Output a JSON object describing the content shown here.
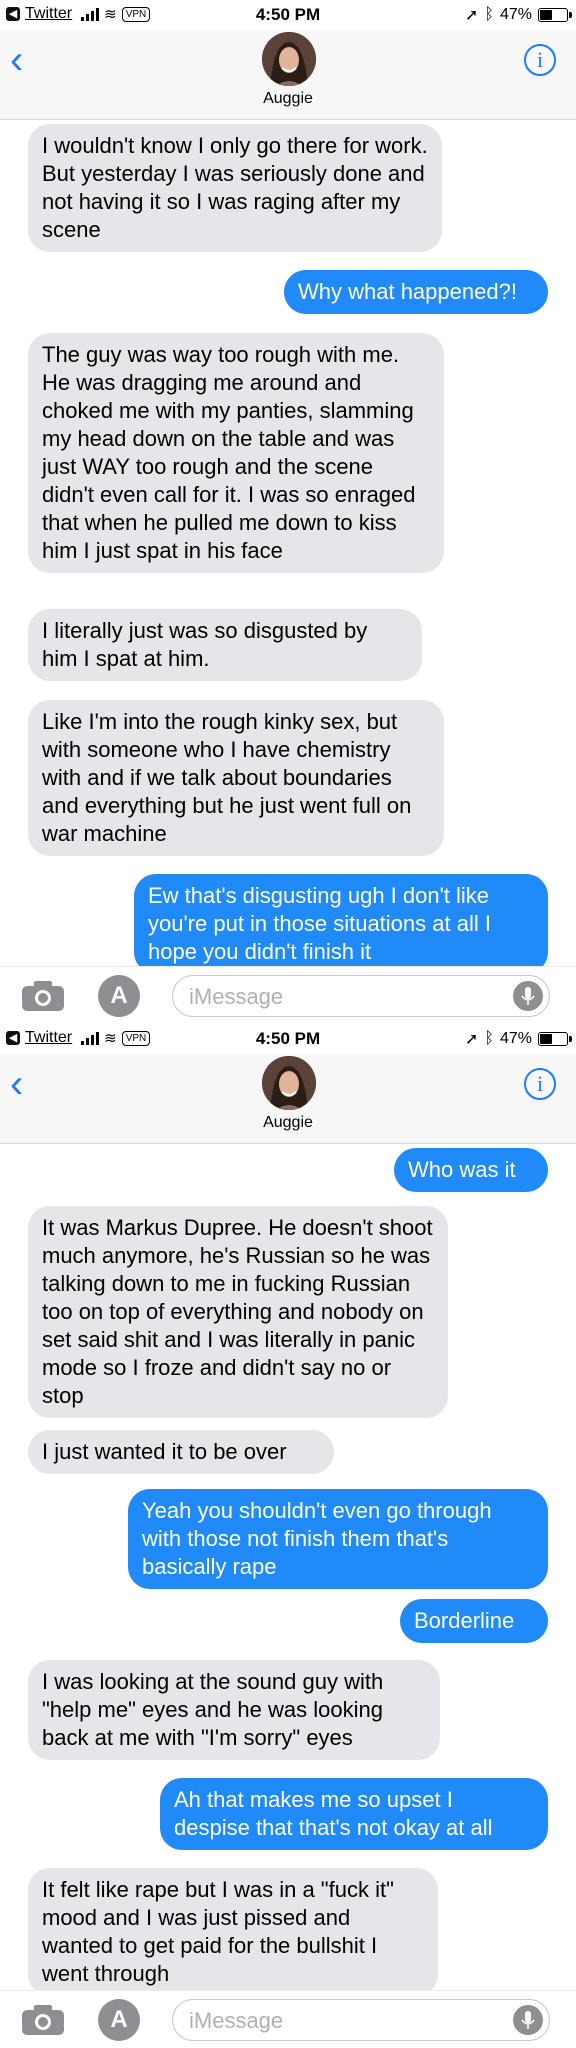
{
  "status": {
    "back_app": "Twitter",
    "vpn": "VPN",
    "time": "4:50 PM",
    "battery": "47%",
    "battery_level": 0.47
  },
  "contact": {
    "name": "Auggie"
  },
  "input": {
    "placeholder": "iMessage"
  },
  "screens": [
    {
      "messages": [
        {
          "side": "received",
          "text": "I wouldn't know I only go there for work. But yesterday I was seriously done and not having it so I was raging after my scene"
        },
        {
          "side": "sent",
          "text": "Why what happened?!"
        },
        {
          "side": "received",
          "text": "The guy was way too rough with me. He was dragging me around and choked me with my panties, slamming my head down on the table and was just WAY too rough and the scene didn't even call for it. I was so enraged that when he pulled me down to kiss him I just spat in his face"
        },
        {
          "side": "received",
          "text": "I literally just was so disgusted by him I spat at him."
        },
        {
          "side": "received",
          "text": "Like I'm into the rough kinky sex, but with someone who I have chemistry with and if we talk about boundaries and everything but he just went full on war machine"
        },
        {
          "side": "sent",
          "text": "Ew that's disgusting ugh I don't like you're put in those situations at all I hope you didn't finish it"
        }
      ]
    },
    {
      "messages": [
        {
          "side": "sent",
          "text": "Who was it"
        },
        {
          "side": "received",
          "text": "It was Markus Dupree. He doesn't shoot much anymore, he's Russian so he was talking down to me in fucking Russian too on top of everything and nobody on set said shit and I was literally in panic mode so I froze and didn't say no or stop"
        },
        {
          "side": "received",
          "text": "I just wanted it to be over"
        },
        {
          "side": "sent",
          "text": "Yeah you shouldn't even go through with those not finish them that's basically rape"
        },
        {
          "side": "sent",
          "text": "Borderline"
        },
        {
          "side": "received",
          "text": "I was looking at the sound guy with \"help me\" eyes and he was looking back at me with \"I'm sorry\" eyes"
        },
        {
          "side": "sent",
          "text": "Ah that makes me so upset I despise that that's not okay at all"
        },
        {
          "side": "received",
          "text": "It felt like rape but I was in a \"fuck it\" mood and I was just pissed and wanted to get paid for the bullshit I went through"
        }
      ]
    }
  ],
  "colors": {
    "accent": "#1b7cf6",
    "sent_bubble": "#1f8af8",
    "received_bubble": "#e5e5ea"
  },
  "icons": {
    "back": "chevron-left-icon",
    "info": "info-icon",
    "camera": "camera-icon",
    "apps": "app-store-icon",
    "mic": "microphone-icon"
  }
}
